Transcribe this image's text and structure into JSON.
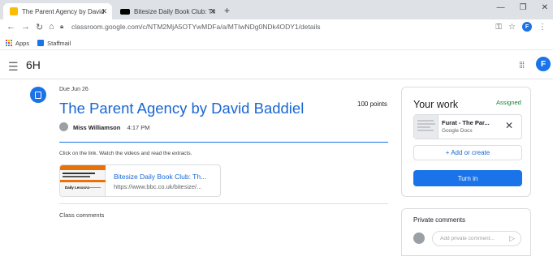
{
  "browser": {
    "tabs": [
      {
        "label": "The Parent Agency by David Bad",
        "active": true
      },
      {
        "label": "Bitesize Daily Book Club: The Par",
        "active": false
      }
    ],
    "new_tab": "+",
    "url": "classroom.google.com/c/NTM2MjA5OTYwMDFa/a/MTIwNDg0NDk4ODY1/details",
    "profile_initial": "F",
    "bookmarks": [
      {
        "label": "Apps",
        "icon": "apps-grid-icon"
      },
      {
        "label": "Staffmail",
        "icon": "staffmail-icon"
      }
    ]
  },
  "app": {
    "class_name": "6H",
    "profile_initial": "F",
    "accent": "#1a73e8"
  },
  "assignment": {
    "due": "Due Jun 26",
    "title": "The Parent Agency by David Baddiel",
    "points": "100 points",
    "teacher": "Miss Williamson",
    "time": "4:17 PM",
    "instructions": "Click on the link. Watch the videos and read the extracts.",
    "attachment": {
      "title": "Bitesize Daily Book Club: Th...",
      "url": "https://www.bbc.co.uk/bitesize/...",
      "thumb_label": "Daily Lessons"
    },
    "class_comments_label": "Class comments"
  },
  "your_work": {
    "title": "Your work",
    "status": "Assigned",
    "status_color": "#188038",
    "file": {
      "name": "Furat     - The Par...",
      "type": "Google Docs"
    },
    "add_or_create": "+ Add or create",
    "turn_in": "Turn in"
  },
  "private_comments": {
    "title": "Private comments",
    "placeholder": "Add private comment..."
  }
}
